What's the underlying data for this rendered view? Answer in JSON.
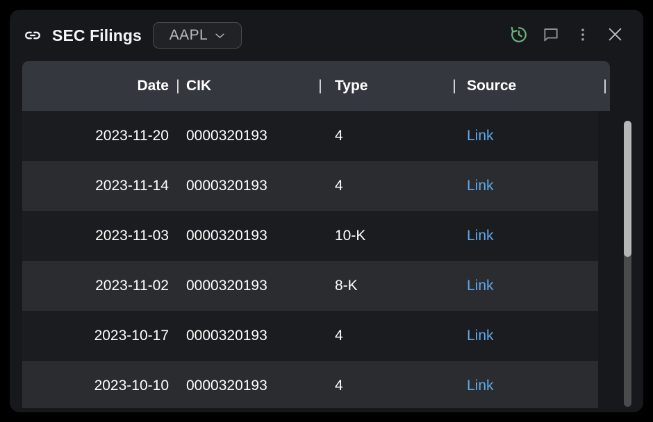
{
  "window": {
    "title": "SEC Filings",
    "link_icon": "link-icon",
    "ticker": {
      "label": "AAPL",
      "chevron_icon": "chevron-down-icon"
    },
    "actions": [
      {
        "name": "history-icon",
        "tooltip": "History"
      },
      {
        "name": "comment-icon",
        "tooltip": "Comment"
      },
      {
        "name": "more-vertical-icon",
        "tooltip": "More options"
      },
      {
        "name": "close-icon",
        "tooltip": "Close"
      }
    ]
  },
  "colors": {
    "page_background": "#000000",
    "panel_background": "#17181b",
    "table_header_background": "#35373f",
    "row_even_background": "#1b1c1f",
    "row_odd_background": "#2a2c30",
    "link": "#5fa8e9",
    "history_accent": "#6ab47b",
    "icon_gray": "#8d8f93",
    "text_primary": "#ffffff",
    "scrollbar_thumb": "#b5b6b8",
    "scrollbar_track": "#4a4b4d"
  },
  "table": {
    "separator": "|",
    "columns": [
      "Date",
      "CIK",
      "Type",
      "Source"
    ],
    "rows": [
      {
        "date": "2023-11-20",
        "cik": "0000320193",
        "type": "4",
        "source": "Link"
      },
      {
        "date": "2023-11-14",
        "cik": "0000320193",
        "type": "4",
        "source": "Link"
      },
      {
        "date": "2023-11-03",
        "cik": "0000320193",
        "type": "10-K",
        "source": "Link"
      },
      {
        "date": "2023-11-02",
        "cik": "0000320193",
        "type": "8-K",
        "source": "Link"
      },
      {
        "date": "2023-10-17",
        "cik": "0000320193",
        "type": "4",
        "source": "Link"
      },
      {
        "date": "2023-10-10",
        "cik": "0000320193",
        "type": "4",
        "source": "Link"
      }
    ]
  },
  "scrollbar": {
    "name": "vertical-scrollbar"
  }
}
